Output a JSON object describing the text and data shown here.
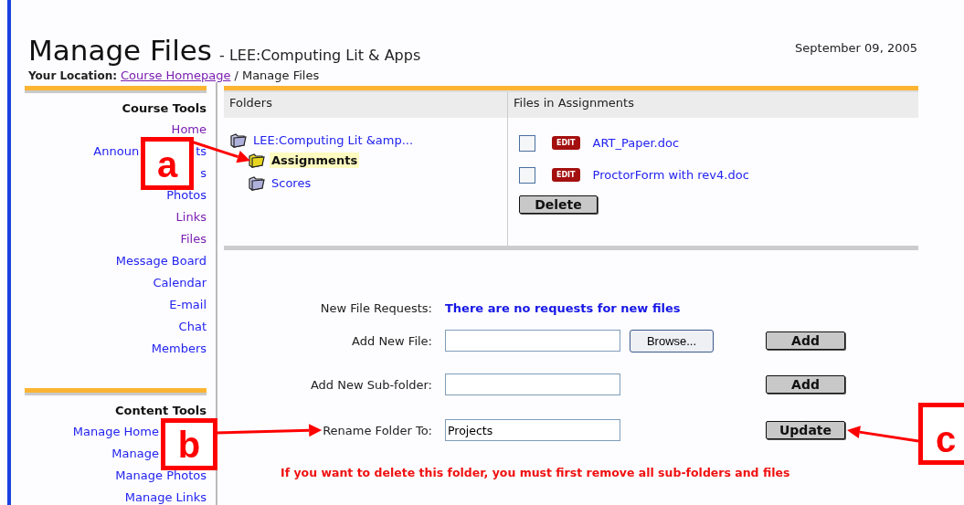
{
  "header": {
    "title": "Manage Files",
    "subtitle": "- LEE:Computing Lit & Apps",
    "location_label": "Your Location:",
    "location_link": "Course Homepage",
    "location_current": "/ Manage Files",
    "date": "September 09, 2005"
  },
  "sidebar": {
    "sections": [
      {
        "title": "Course Tools",
        "items": [
          {
            "kind": "link",
            "parts": [
              "Home"
            ],
            "visited": true
          },
          {
            "kind": "split",
            "parts": [
              "Announ",
              "ts"
            ],
            "visited": false
          },
          {
            "kind": "link",
            "parts": [
              "s"
            ],
            "visited": false
          },
          {
            "kind": "link",
            "parts": [
              "Photos"
            ],
            "visited": false
          },
          {
            "kind": "link",
            "parts": [
              "Links"
            ],
            "visited": true
          },
          {
            "kind": "link",
            "parts": [
              "Files"
            ],
            "visited": true
          },
          {
            "kind": "link",
            "parts": [
              "Message Board"
            ],
            "visited": false
          },
          {
            "kind": "link",
            "parts": [
              "Calendar"
            ],
            "visited": false
          },
          {
            "kind": "link",
            "parts": [
              "E-mail"
            ],
            "visited": false
          },
          {
            "kind": "link",
            "parts": [
              "Chat"
            ],
            "visited": false
          },
          {
            "kind": "link",
            "parts": [
              "Members"
            ],
            "visited": false
          }
        ]
      },
      {
        "title": "Content Tools",
        "items": [
          {
            "kind": "head",
            "parts": [
              "Manage Home"
            ],
            "visited": false
          },
          {
            "kind": "head",
            "parts": [
              "Manage"
            ],
            "visited": false
          },
          {
            "kind": "link",
            "parts": [
              "Manage Photos"
            ],
            "visited": false
          },
          {
            "kind": "link",
            "parts": [
              "Manage Links"
            ],
            "visited": false
          }
        ]
      }
    ]
  },
  "folders": {
    "heading": "Folders",
    "items": [
      {
        "label": "LEE:Computing Lit &amp...",
        "selected": false,
        "children": [
          {
            "label": "Assignments",
            "selected": true
          },
          {
            "label": "Scores",
            "selected": false
          }
        ]
      }
    ]
  },
  "files": {
    "heading": "Files in Assignments",
    "items": [
      {
        "name": "ART_Paper.doc",
        "checked": false,
        "badge": "EDIT"
      },
      {
        "name": "ProctorForm with rev4.doc",
        "checked": false,
        "badge": "EDIT"
      }
    ],
    "delete_button": "Delete"
  },
  "form": {
    "rows": [
      {
        "kind": "message",
        "label": "New File Requests:",
        "text": "There are no requests for new files"
      },
      {
        "kind": "file",
        "label": "Add New File:",
        "browse": "Browse...",
        "button": "Add"
      },
      {
        "kind": "text",
        "label": "Add New Sub-folder:",
        "button": "Add"
      },
      {
        "kind": "text",
        "label": "Rename Folder To:",
        "value": "Projects",
        "button": "Update"
      }
    ],
    "warning": "If you want to delete this folder, you must first remove all sub-folders and files"
  },
  "callouts": [
    {
      "label": "a"
    },
    {
      "label": "b"
    },
    {
      "label": "c"
    }
  ]
}
